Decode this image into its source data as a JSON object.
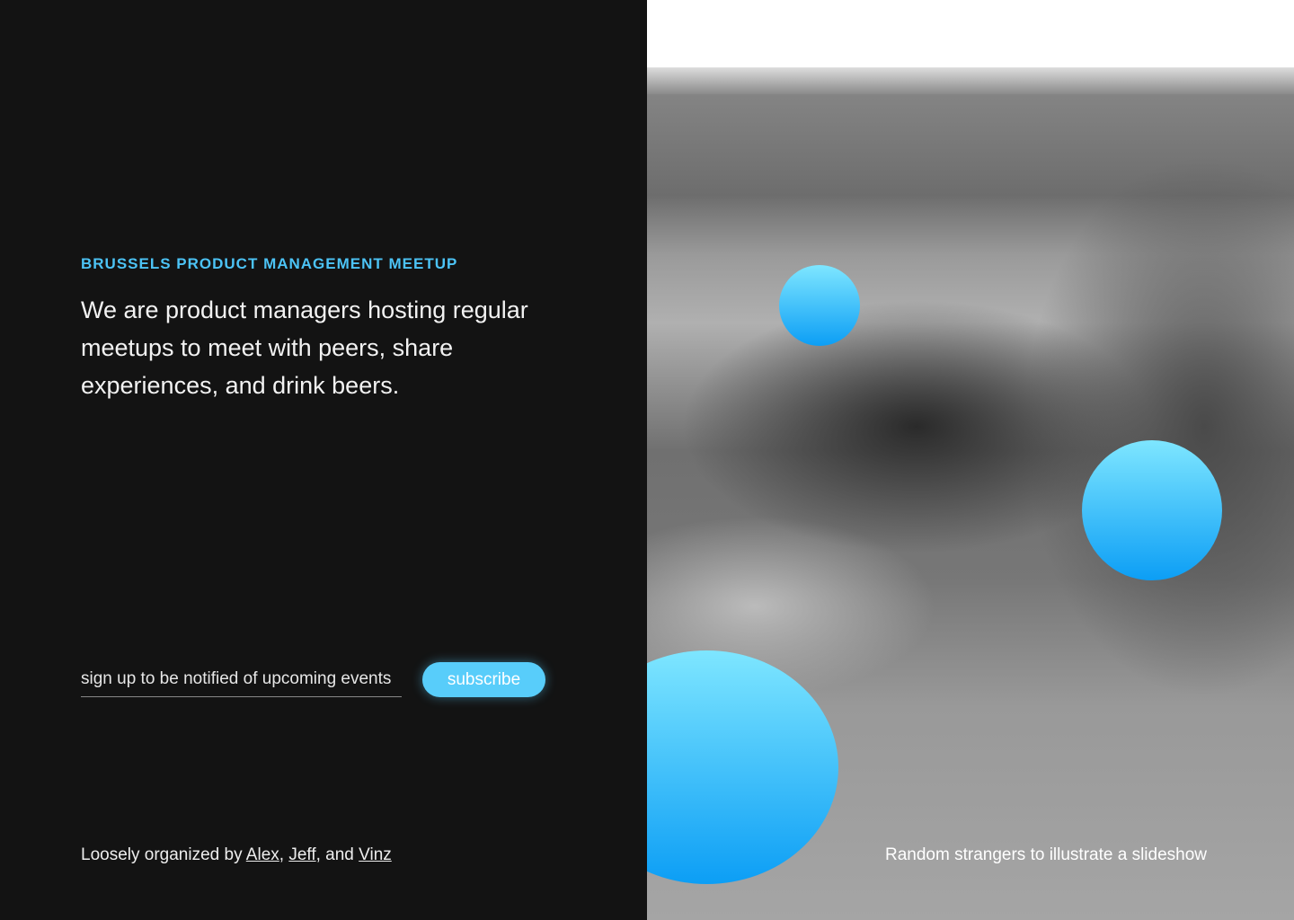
{
  "eyebrow": "BRUSSELS PRODUCT MANAGEMENT MEETUP",
  "lead": "We are product managers hosting regular meetups to meet with peers, share experiences, and drink beers.",
  "signup": {
    "placeholder": "sign up to be notified of upcoming events",
    "button": "subscribe"
  },
  "credits": {
    "prefix": "Loosely organized by ",
    "names": [
      "Alex",
      "Jeff",
      "Vinz"
    ],
    "sep1": ", ",
    "sep2": ", and "
  },
  "photo": {
    "caption": "Random strangers to illustrate a slideshow"
  },
  "colors": {
    "accent": "#4cc3f5",
    "button": "#58cdfa",
    "background": "#131313"
  }
}
